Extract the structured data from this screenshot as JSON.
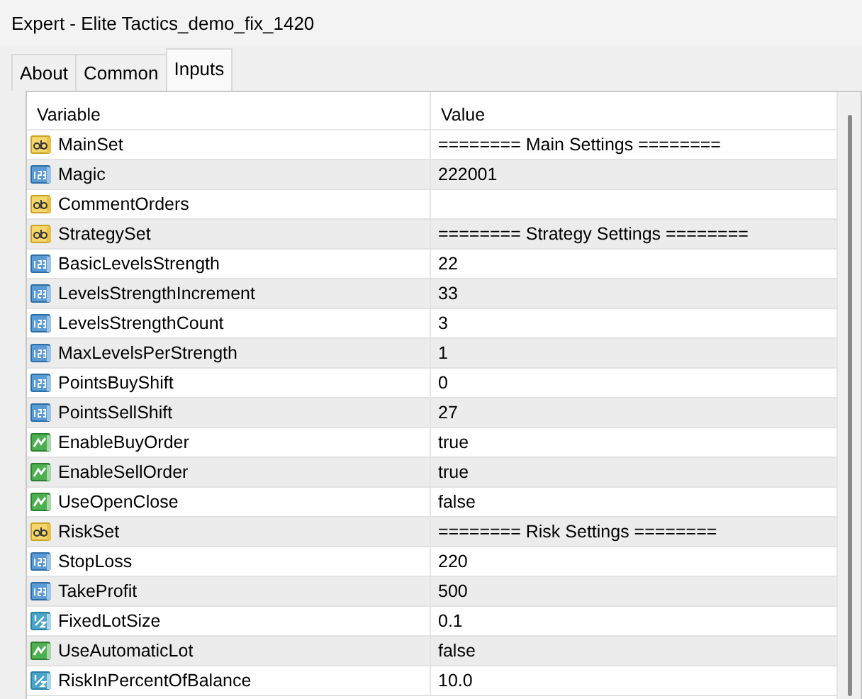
{
  "window": {
    "title": "Expert - Elite Tactics_demo_fix_1420"
  },
  "tabs": [
    {
      "label": "About",
      "selected": false
    },
    {
      "label": "Common",
      "selected": false
    },
    {
      "label": "Inputs",
      "selected": true
    }
  ],
  "table": {
    "columns": [
      "Variable",
      "Value"
    ],
    "rows": [
      {
        "kind": "string",
        "variable": "MainSet",
        "value": "======== Main Settings ========"
      },
      {
        "kind": "integer",
        "variable": "Magic",
        "value": "222001"
      },
      {
        "kind": "string",
        "variable": "CommentOrders"
      },
      {
        "kind": "string",
        "variable": "StrategySet",
        "value": "======== Strategy Settings ========"
      },
      {
        "kind": "integer",
        "variable": "BasicLevelsStrength",
        "value": "22"
      },
      {
        "kind": "integer",
        "variable": "LevelsStrengthIncrement",
        "value": "33"
      },
      {
        "kind": "integer",
        "variable": "LevelsStrengthCount",
        "value": "3"
      },
      {
        "kind": "integer",
        "variable": "MaxLevelsPerStrength",
        "value": "1"
      },
      {
        "kind": "integer",
        "variable": "PointsBuyShift",
        "value": "0"
      },
      {
        "kind": "integer",
        "variable": "PointsSellShift",
        "value": "27"
      },
      {
        "kind": "boolean",
        "variable": "EnableBuyOrder",
        "value": "true"
      },
      {
        "kind": "boolean",
        "variable": "EnableSellOrder",
        "value": "true"
      },
      {
        "kind": "boolean",
        "variable": "UseOpenClose",
        "value": "false"
      },
      {
        "kind": "string",
        "variable": "RiskSet",
        "value": "======== Risk Settings ========"
      },
      {
        "kind": "integer",
        "variable": "StopLoss",
        "value": "220"
      },
      {
        "kind": "integer",
        "variable": "TakeProfit",
        "value": "500"
      },
      {
        "kind": "double",
        "variable": "FixedLotSize",
        "value": "0.1"
      },
      {
        "kind": "boolean",
        "variable": "UseAutomaticLot",
        "value": "false"
      },
      {
        "kind": "double",
        "variable": "RiskInPercentOfBalance",
        "value": "10.0"
      }
    ]
  }
}
